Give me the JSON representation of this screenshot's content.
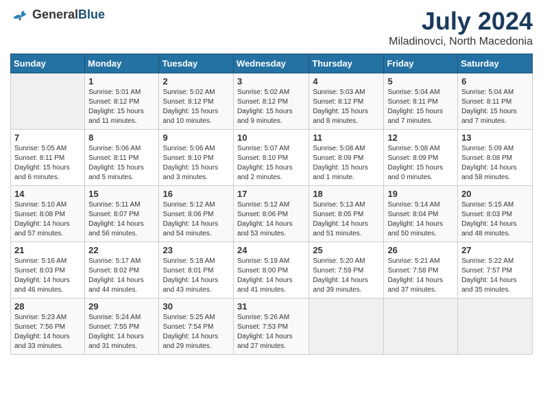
{
  "header": {
    "logo_general": "General",
    "logo_blue": "Blue",
    "month_year": "July 2024",
    "location": "Miladinovci, North Macedonia"
  },
  "weekdays": [
    "Sunday",
    "Monday",
    "Tuesday",
    "Wednesday",
    "Thursday",
    "Friday",
    "Saturday"
  ],
  "weeks": [
    [
      {
        "day": "",
        "sunrise": "",
        "sunset": "",
        "daylight": ""
      },
      {
        "day": "1",
        "sunrise": "Sunrise: 5:01 AM",
        "sunset": "Sunset: 8:12 PM",
        "daylight": "Daylight: 15 hours and 11 minutes."
      },
      {
        "day": "2",
        "sunrise": "Sunrise: 5:02 AM",
        "sunset": "Sunset: 8:12 PM",
        "daylight": "Daylight: 15 hours and 10 minutes."
      },
      {
        "day": "3",
        "sunrise": "Sunrise: 5:02 AM",
        "sunset": "Sunset: 8:12 PM",
        "daylight": "Daylight: 15 hours and 9 minutes."
      },
      {
        "day": "4",
        "sunrise": "Sunrise: 5:03 AM",
        "sunset": "Sunset: 8:12 PM",
        "daylight": "Daylight: 15 hours and 8 minutes."
      },
      {
        "day": "5",
        "sunrise": "Sunrise: 5:04 AM",
        "sunset": "Sunset: 8:11 PM",
        "daylight": "Daylight: 15 hours and 7 minutes."
      },
      {
        "day": "6",
        "sunrise": "Sunrise: 5:04 AM",
        "sunset": "Sunset: 8:11 PM",
        "daylight": "Daylight: 15 hours and 7 minutes."
      }
    ],
    [
      {
        "day": "7",
        "sunrise": "Sunrise: 5:05 AM",
        "sunset": "Sunset: 8:11 PM",
        "daylight": "Daylight: 15 hours and 6 minutes."
      },
      {
        "day": "8",
        "sunrise": "Sunrise: 5:06 AM",
        "sunset": "Sunset: 8:11 PM",
        "daylight": "Daylight: 15 hours and 5 minutes."
      },
      {
        "day": "9",
        "sunrise": "Sunrise: 5:06 AM",
        "sunset": "Sunset: 8:10 PM",
        "daylight": "Daylight: 15 hours and 3 minutes."
      },
      {
        "day": "10",
        "sunrise": "Sunrise: 5:07 AM",
        "sunset": "Sunset: 8:10 PM",
        "daylight": "Daylight: 15 hours and 2 minutes."
      },
      {
        "day": "11",
        "sunrise": "Sunrise: 5:08 AM",
        "sunset": "Sunset: 8:09 PM",
        "daylight": "Daylight: 15 hours and 1 minute."
      },
      {
        "day": "12",
        "sunrise": "Sunrise: 5:08 AM",
        "sunset": "Sunset: 8:09 PM",
        "daylight": "Daylight: 15 hours and 0 minutes."
      },
      {
        "day": "13",
        "sunrise": "Sunrise: 5:09 AM",
        "sunset": "Sunset: 8:08 PM",
        "daylight": "Daylight: 14 hours and 58 minutes."
      }
    ],
    [
      {
        "day": "14",
        "sunrise": "Sunrise: 5:10 AM",
        "sunset": "Sunset: 8:08 PM",
        "daylight": "Daylight: 14 hours and 57 minutes."
      },
      {
        "day": "15",
        "sunrise": "Sunrise: 5:11 AM",
        "sunset": "Sunset: 8:07 PM",
        "daylight": "Daylight: 14 hours and 56 minutes."
      },
      {
        "day": "16",
        "sunrise": "Sunrise: 5:12 AM",
        "sunset": "Sunset: 8:06 PM",
        "daylight": "Daylight: 14 hours and 54 minutes."
      },
      {
        "day": "17",
        "sunrise": "Sunrise: 5:12 AM",
        "sunset": "Sunset: 8:06 PM",
        "daylight": "Daylight: 14 hours and 53 minutes."
      },
      {
        "day": "18",
        "sunrise": "Sunrise: 5:13 AM",
        "sunset": "Sunset: 8:05 PM",
        "daylight": "Daylight: 14 hours and 51 minutes."
      },
      {
        "day": "19",
        "sunrise": "Sunrise: 5:14 AM",
        "sunset": "Sunset: 8:04 PM",
        "daylight": "Daylight: 14 hours and 50 minutes."
      },
      {
        "day": "20",
        "sunrise": "Sunrise: 5:15 AM",
        "sunset": "Sunset: 8:03 PM",
        "daylight": "Daylight: 14 hours and 48 minutes."
      }
    ],
    [
      {
        "day": "21",
        "sunrise": "Sunrise: 5:16 AM",
        "sunset": "Sunset: 8:03 PM",
        "daylight": "Daylight: 14 hours and 46 minutes."
      },
      {
        "day": "22",
        "sunrise": "Sunrise: 5:17 AM",
        "sunset": "Sunset: 8:02 PM",
        "daylight": "Daylight: 14 hours and 44 minutes."
      },
      {
        "day": "23",
        "sunrise": "Sunrise: 5:18 AM",
        "sunset": "Sunset: 8:01 PM",
        "daylight": "Daylight: 14 hours and 43 minutes."
      },
      {
        "day": "24",
        "sunrise": "Sunrise: 5:19 AM",
        "sunset": "Sunset: 8:00 PM",
        "daylight": "Daylight: 14 hours and 41 minutes."
      },
      {
        "day": "25",
        "sunrise": "Sunrise: 5:20 AM",
        "sunset": "Sunset: 7:59 PM",
        "daylight": "Daylight: 14 hours and 39 minutes."
      },
      {
        "day": "26",
        "sunrise": "Sunrise: 5:21 AM",
        "sunset": "Sunset: 7:58 PM",
        "daylight": "Daylight: 14 hours and 37 minutes."
      },
      {
        "day": "27",
        "sunrise": "Sunrise: 5:22 AM",
        "sunset": "Sunset: 7:57 PM",
        "daylight": "Daylight: 14 hours and 35 minutes."
      }
    ],
    [
      {
        "day": "28",
        "sunrise": "Sunrise: 5:23 AM",
        "sunset": "Sunset: 7:56 PM",
        "daylight": "Daylight: 14 hours and 33 minutes."
      },
      {
        "day": "29",
        "sunrise": "Sunrise: 5:24 AM",
        "sunset": "Sunset: 7:55 PM",
        "daylight": "Daylight: 14 hours and 31 minutes."
      },
      {
        "day": "30",
        "sunrise": "Sunrise: 5:25 AM",
        "sunset": "Sunset: 7:54 PM",
        "daylight": "Daylight: 14 hours and 29 minutes."
      },
      {
        "day": "31",
        "sunrise": "Sunrise: 5:26 AM",
        "sunset": "Sunset: 7:53 PM",
        "daylight": "Daylight: 14 hours and 27 minutes."
      },
      {
        "day": "",
        "sunrise": "",
        "sunset": "",
        "daylight": ""
      },
      {
        "day": "",
        "sunrise": "",
        "sunset": "",
        "daylight": ""
      },
      {
        "day": "",
        "sunrise": "",
        "sunset": "",
        "daylight": ""
      }
    ]
  ]
}
